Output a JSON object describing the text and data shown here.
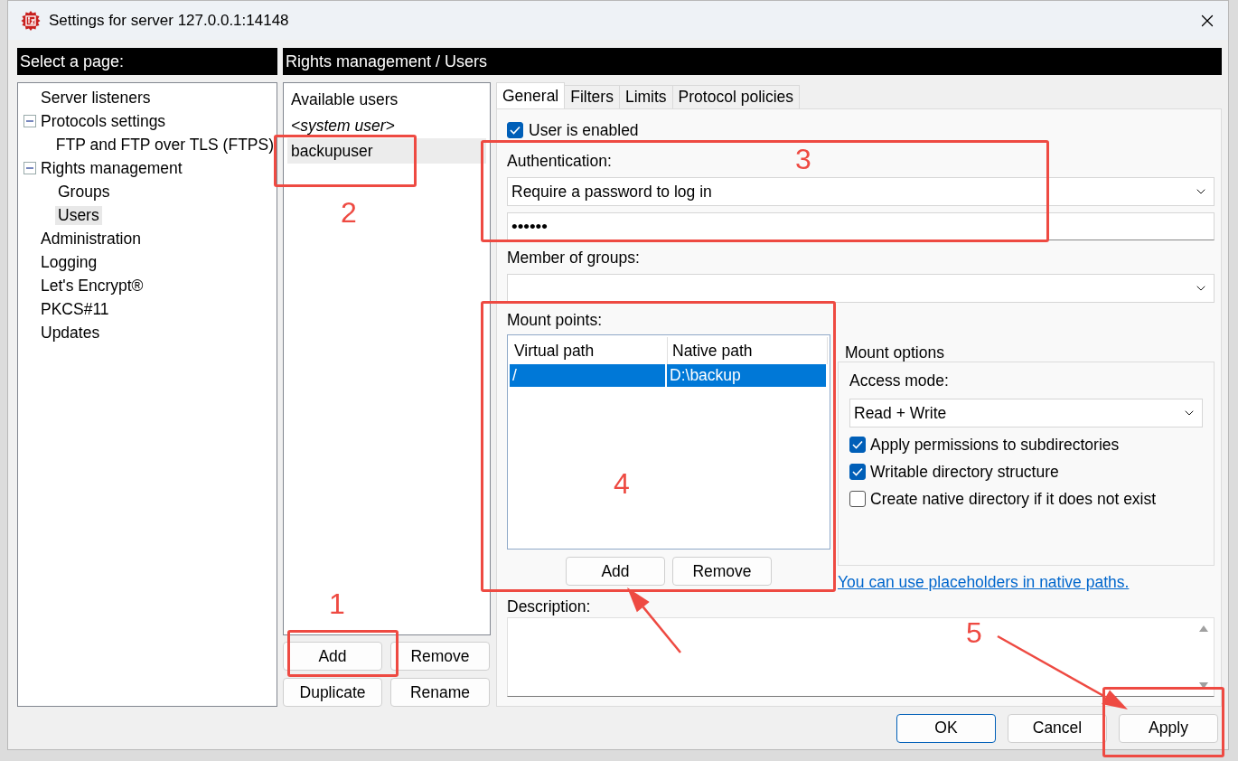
{
  "window": {
    "title": "Settings for server 127.0.0.1:14148"
  },
  "sidebar": {
    "header": "Select a page:",
    "items": [
      {
        "label": "Server listeners",
        "selected": false
      },
      {
        "label": "Protocols settings",
        "selected": false,
        "expanded": true,
        "children": [
          {
            "label": "FTP and FTP over TLS (FTPS)",
            "selected": false
          }
        ]
      },
      {
        "label": "Rights management",
        "selected": false,
        "expanded": true,
        "children": [
          {
            "label": "Groups",
            "selected": false
          },
          {
            "label": "Users",
            "selected": true
          }
        ]
      },
      {
        "label": "Administration",
        "selected": false
      },
      {
        "label": "Logging",
        "selected": false
      },
      {
        "label": "Let's Encrypt®",
        "selected": false
      },
      {
        "label": "PKCS#11",
        "selected": false
      },
      {
        "label": "Updates",
        "selected": false
      }
    ]
  },
  "page_header": "Rights management / Users",
  "users": {
    "header": "Available users",
    "items": [
      {
        "name": "<system user>",
        "kind": "system",
        "selected": false
      },
      {
        "name": "backupuser",
        "kind": "user",
        "selected": true
      }
    ],
    "buttons": [
      "Add",
      "Remove",
      "Duplicate",
      "Rename"
    ]
  },
  "tabs": [
    {
      "label": "General",
      "selected": true
    },
    {
      "label": "Filters",
      "selected": false
    },
    {
      "label": "Limits",
      "selected": false
    },
    {
      "label": "Protocol policies",
      "selected": false
    }
  ],
  "general": {
    "user_enabled": {
      "label": "User is enabled",
      "checked": true
    },
    "authentication": {
      "label": "Authentication:",
      "value": "Require a password to log in"
    },
    "password": {
      "value": "••••••"
    },
    "member_of_groups": {
      "label": "Member of groups:"
    },
    "mount_points": {
      "label": "Mount points:",
      "columns": [
        "Virtual path",
        "Native path"
      ],
      "rows": [
        {
          "cells": [
            "/",
            "D:\\backup"
          ],
          "selected": true
        }
      ],
      "buttons": [
        "Add",
        "Remove"
      ]
    },
    "mount_options": {
      "title": "Mount options",
      "access_mode": {
        "label": "Access mode:",
        "value": "Read + Write"
      },
      "options": [
        {
          "label": "Apply permissions to subdirectories",
          "checked": true
        },
        {
          "label": "Writable directory structure",
          "checked": true
        },
        {
          "label": "Create native directory if it does not exist",
          "checked": false
        }
      ]
    },
    "link": "You can use placeholders in native paths.",
    "description": {
      "label": "Description:"
    }
  },
  "footer_buttons": [
    {
      "label": "OK",
      "primary": true
    },
    {
      "label": "Cancel",
      "primary": false
    },
    {
      "label": "Apply",
      "primary": false
    }
  ],
  "annotations": [
    {
      "number": "1",
      "arrow": false
    },
    {
      "number": "2",
      "arrow": false
    },
    {
      "number": "3",
      "arrow": false
    },
    {
      "number": "4",
      "arrow": true
    },
    {
      "number": "5",
      "arrow": true
    }
  ]
}
